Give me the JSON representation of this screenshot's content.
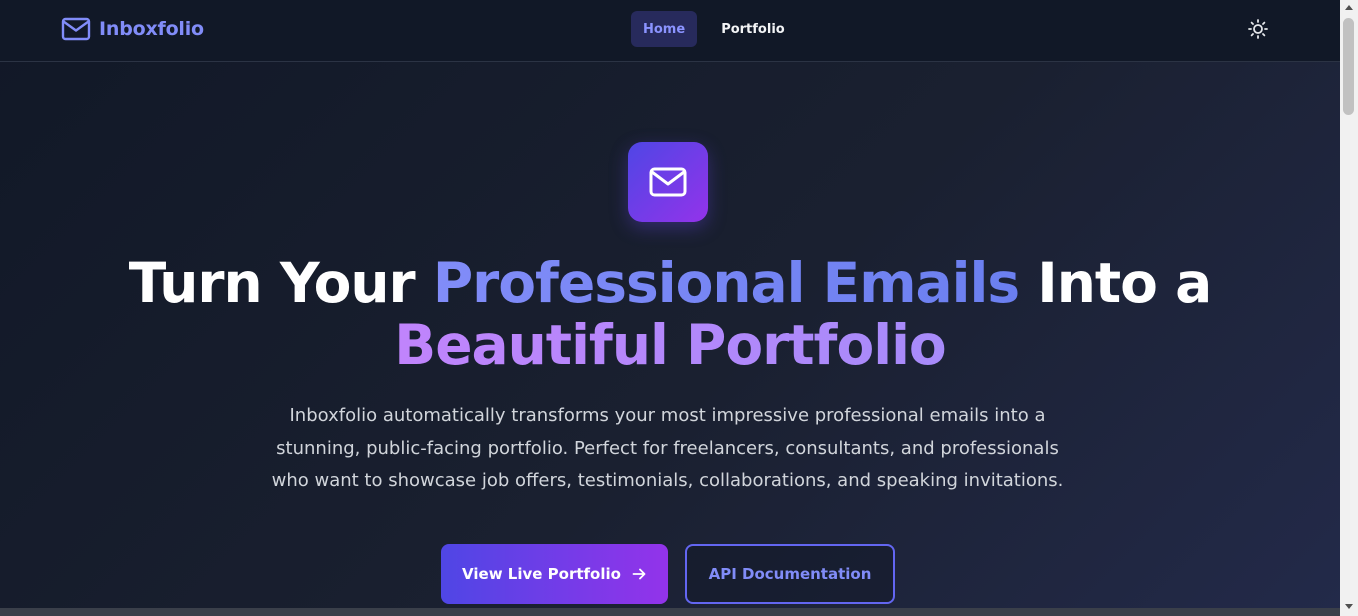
{
  "header": {
    "brand_name": "Inboxfolio",
    "brand_icon": "mail-icon",
    "nav": [
      {
        "label": "Home",
        "active": true
      },
      {
        "label": "Portfolio",
        "active": false
      }
    ],
    "theme_toggle_icon": "sun-icon"
  },
  "hero": {
    "icon": "mail-icon",
    "headline": {
      "part1": "Turn Your ",
      "part2": "Professional Emails",
      "part3": " Into a",
      "part4": "Beautiful Portfolio"
    },
    "description": "Inboxfolio automatically transforms your most impressive professional emails into a stunning, public-facing portfolio. Perfect for freelancers, consultants, and professionals who want to showcase job offers, testimonials, collaborations, and speaking invitations.",
    "primary_button": {
      "label": "View Live Portfolio",
      "icon": "arrow-right-icon"
    },
    "secondary_button": {
      "label": "API Documentation"
    }
  },
  "colors": {
    "background": "#111827",
    "accent": "#818cf8",
    "gradient_start": "#4f46e5",
    "gradient_end": "#9333ea",
    "purple_text": "#c084fc"
  }
}
